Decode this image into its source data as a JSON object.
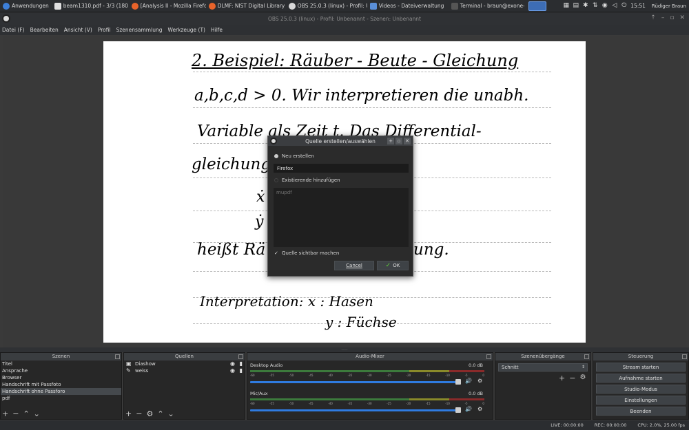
{
  "taskbar": {
    "items": [
      {
        "label": "Anwendungen",
        "color": "#3d7fd8"
      },
      {
        "label": "beam1310.pdf - 3/3 (180 dpi)",
        "color": "#e0e0e0"
      },
      {
        "label": "[Analysis II - Mozilla Firefox]",
        "color": "#e8632a"
      },
      {
        "label": "DLMF: NIST Digital Library of...",
        "color": "#e8632a"
      },
      {
        "label": "OBS 25.0.3 (linux) - Profil: Un...",
        "color": "#d8d8d8"
      },
      {
        "label": "Videos - Dateiverwaltung",
        "color": "#5a8fd8"
      },
      {
        "label": "Terminal - braun@exone-PC:...",
        "color": "#555"
      }
    ],
    "clock": "15:51",
    "user": "Rüdiger Braun"
  },
  "window": {
    "title": "OBS 25.0.3 (linux) - Profil: Unbenannt - Szenen: Unbenannt"
  },
  "menu": [
    "Datei (F)",
    "Bearbeiten",
    "Ansicht (V)",
    "Profil",
    "Szenensammlung",
    "Werkzeuge (T)",
    "Hilfe"
  ],
  "handwriting": {
    "line1": "2. Beispiel:   Räuber - Beute - Gleichung",
    "line2": "a,b,c,d > 0.   Wir interpretieren die unabh.",
    "line3": "Variable als  Zeit   t.    Das Differential-",
    "line4": "gleichungssystem",
    "line5": "ẋ",
    "line6": "ẏ",
    "line7": "heißt  Rä",
    "line7b": "ung.",
    "line8": "Interpretation:      x :  Hasen",
    "line9": "y :  Füchse"
  },
  "dialog": {
    "title": "Quelle erstellen/auswählen",
    "option_new": "Neu erstellen",
    "name_value": "Firefox",
    "option_existing": "Existierende hinzufügen",
    "existing_items": [
      "mupdf"
    ],
    "visible_label": "Quelle sichtbar machen",
    "cancel": "Cancel",
    "ok": "OK"
  },
  "docks": {
    "scenes": {
      "title": "Szenen",
      "items": [
        "Titel",
        "Ansprache",
        "Browser",
        "Handschrift mit Passfoto",
        "Handschrift ohne Passforo",
        "pdf"
      ],
      "selected_index": 4
    },
    "sources": {
      "title": "Quellen",
      "items": [
        "Diashow",
        "weiss"
      ]
    },
    "mixer": {
      "title": "Audio-Mixer",
      "channels": [
        {
          "name": "Desktop Audio",
          "db": "0.0 dB",
          "volume": 1.0
        },
        {
          "name": "Mic/Aux",
          "db": "0.0 dB",
          "volume": 1.0
        }
      ],
      "scale": [
        "-60",
        "-55",
        "-50",
        "-45",
        "-40",
        "-35",
        "-30",
        "-25",
        "-20",
        "-15",
        "-10",
        "-5",
        "0"
      ]
    },
    "transitions": {
      "title": "Szenenübergänge",
      "selected": "Schnitt"
    },
    "controls": {
      "title": "Steuerung",
      "buttons": [
        "Stream starten",
        "Aufnahme starten",
        "Studio-Modus",
        "Einstellungen",
        "Beenden"
      ]
    }
  },
  "status": {
    "live": "LIVE: 00:00:00",
    "rec": "REC: 00:00:00",
    "cpu": "CPU: 2.0%, 25.00 fps"
  }
}
